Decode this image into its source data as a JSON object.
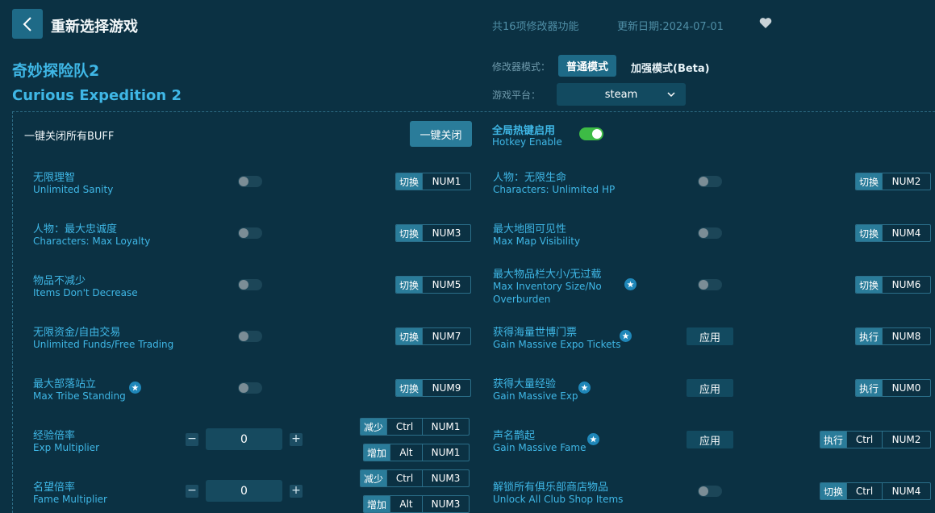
{
  "header": {
    "title": "重新选择游戏",
    "feature_count": "共16项修改器功能",
    "update_date": "更新日期:2024-07-01"
  },
  "game": {
    "name_cn": "奇妙探险队2",
    "name_en": "Curious Expedition 2"
  },
  "mode": {
    "label": "修改器模式：",
    "normal": "普通模式",
    "beta": "加强模式(Beta)"
  },
  "platform": {
    "label": "游戏平台：",
    "value": "steam"
  },
  "controls": {
    "buff_label": "一键关闭所有BUFF",
    "oneclick_button": "一键关闭",
    "hotkey_cn": "全局热键启用",
    "hotkey_en": "Hotkey Enable"
  },
  "left_features": [
    {
      "cn": "无限理智",
      "en": "Unlimited Sanity",
      "tag": "切换",
      "key": "NUM1"
    },
    {
      "cn": "人物：最大忠诚度",
      "en": "Characters: Max Loyalty",
      "tag": "切换",
      "key": "NUM3"
    },
    {
      "cn": "物品不减少",
      "en": "Items Don't Decrease",
      "tag": "切换",
      "key": "NUM5"
    },
    {
      "cn": "无限资金/自由交易",
      "en": "Unlimited Funds/Free Trading",
      "tag": "切换",
      "key": "NUM7"
    },
    {
      "cn": "最大部落站立",
      "en": "Max Tribe Standing",
      "tag": "切换",
      "key": "NUM9"
    }
  ],
  "multipliers": [
    {
      "cn": "经验倍率",
      "en": "Exp Multiplier",
      "value": "0",
      "minus": "−",
      "plus": "+",
      "dec": {
        "tag": "减少",
        "mod": "Ctrl",
        "key": "NUM1"
      },
      "inc": {
        "tag": "增加",
        "mod": "Alt",
        "key": "NUM1"
      }
    },
    {
      "cn": "名望倍率",
      "en": "Fame Multiplier",
      "value": "0",
      "minus": "−",
      "plus": "+",
      "dec": {
        "tag": "减少",
        "mod": "Ctrl",
        "key": "NUM3"
      },
      "inc": {
        "tag": "增加",
        "mod": "Alt",
        "key": "NUM3"
      }
    }
  ],
  "right_features": [
    {
      "cn": "人物：无限生命",
      "en": "Characters: Unlimited HP",
      "tag": "切换",
      "key": "NUM2"
    },
    {
      "cn": "最大地图可见性",
      "en": "Max Map Visibility",
      "tag": "切换",
      "key": "NUM4"
    },
    {
      "cn": "最大物品栏大小/无过载",
      "en1": "Max Inventory Size/No",
      "en2": "Overburden",
      "tag": "切换",
      "key": "NUM6"
    },
    {
      "cn": "获得海量世博门票",
      "en": "Gain Massive Expo Tickets",
      "apply": "应用",
      "tag": "执行",
      "key": "NUM8"
    },
    {
      "cn": "获得大量经验",
      "en": "Gain Massive Exp",
      "apply": "应用",
      "tag": "执行",
      "key": "NUM0"
    },
    {
      "cn": "声名鹊起",
      "en": "Gain Massive Fame",
      "apply": "应用",
      "tag": "执行",
      "mod": "Ctrl",
      "key": "NUM2"
    },
    {
      "cn": "解锁所有俱乐部商店物品",
      "en": "Unlock All Club Shop Items",
      "tag": "切换",
      "mod": "Ctrl",
      "key": "NUM4"
    }
  ],
  "colors": {
    "background": "#0b3143",
    "accent": "#3fb7e6",
    "button": "#1e6a87",
    "toggle_on": "#3dbb45"
  }
}
